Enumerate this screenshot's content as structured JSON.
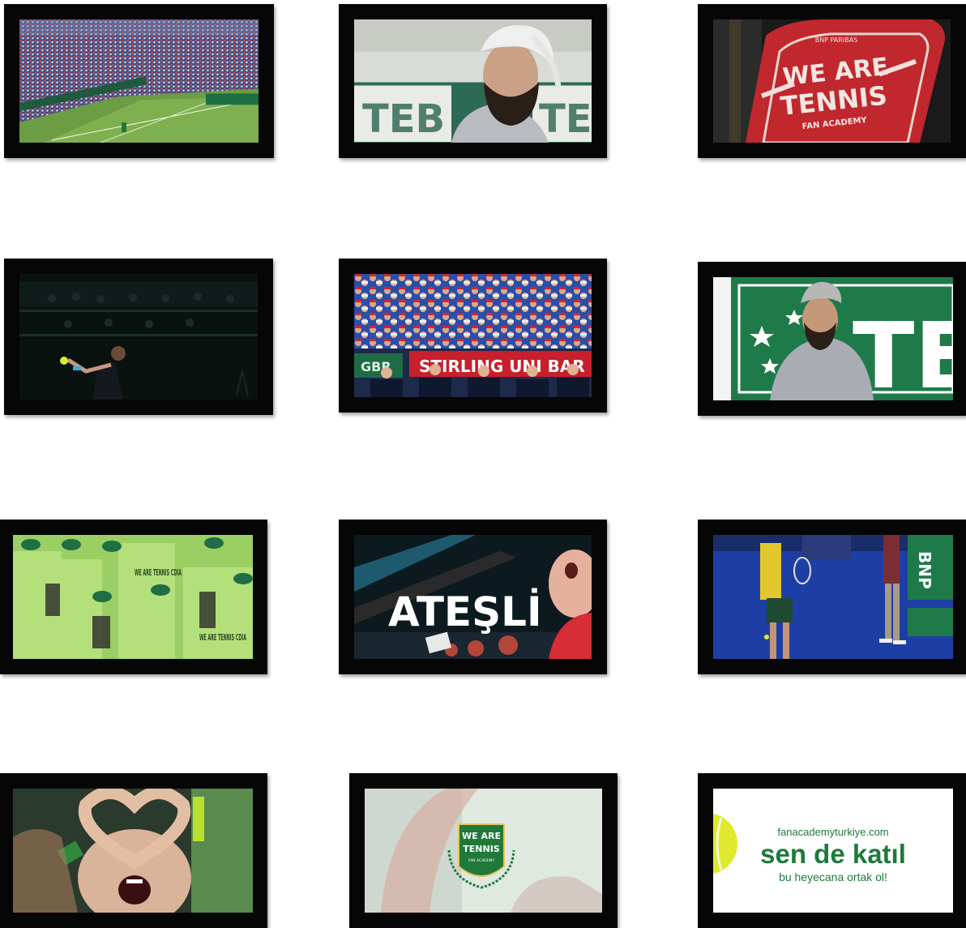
{
  "frames": {
    "f2": {
      "banner_left": "TEB",
      "banner_right": "TEB"
    },
    "f3": {
      "badge_top": "BNP PARIBAS",
      "badge_line1": "WE ARE",
      "badge_line2": "TENNIS",
      "badge_sub": "FAN ACADEMY"
    },
    "f5": {
      "banner_left": "GBR",
      "banner_main": "STIRLING UNI BAR"
    },
    "f6": {
      "banner": "TEB"
    },
    "f7": {
      "shirt1": "WE ARE TENNIS CDIA",
      "shirt2": "WE ARE TENNIS CDIA"
    },
    "f8": {
      "headline": "ATEŞLİ"
    },
    "f9": {
      "banner": "BNP"
    },
    "f11": {
      "logo_line1": "WE ARE",
      "logo_line2": "TENNIS",
      "logo_sub": "FAN ACADEMY"
    },
    "f12": {
      "url": "fanacademyturkiye.com",
      "headline": "sen de katıl",
      "tagline": "bu heyecana ortak ol!"
    }
  },
  "colors": {
    "frame": "#060606",
    "brand_green": "#1f7a3a",
    "fan_red": "#c8262f",
    "court_green": "#6fa04a",
    "court_blue": "#1b3fa8",
    "lime_shirt": "#a7d76a"
  }
}
